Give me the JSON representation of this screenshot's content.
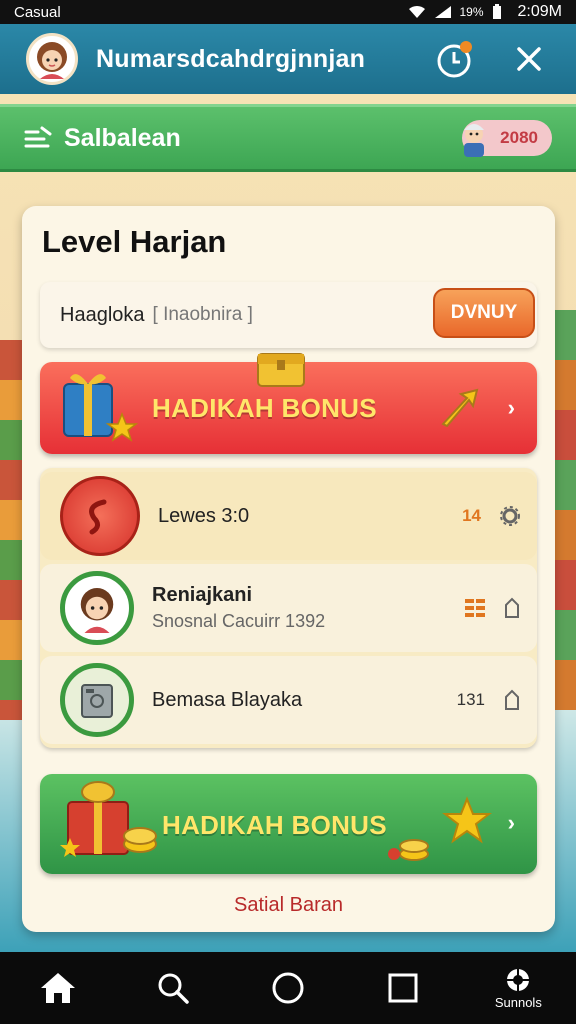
{
  "status_bar": {
    "carrier": "Casual",
    "battery": "19%",
    "time": "2:09M"
  },
  "app_bar": {
    "title": "Numarsdcahdrgjnnjan"
  },
  "green_bar": {
    "title": "Salbalean",
    "coin_value": "2080"
  },
  "panel": {
    "title": "Level Harjan",
    "search": {
      "label": "Haagloka",
      "placeholder": "[ Inaobnira ]",
      "button": "DVNUY"
    },
    "red_banner": {
      "label": "HADIKAH BONUS"
    },
    "list": [
      {
        "main": "Lewes 3:0",
        "sub": "",
        "value": "14"
      },
      {
        "main": "Reniajkani",
        "sub": "Snosnal Cacuirr 1392",
        "value": ""
      },
      {
        "main": "Bemasa Blayaka",
        "sub": "",
        "value": "131"
      }
    ],
    "green_banner": {
      "label": "HADIKAH BONUS"
    },
    "footer_link": "Satial Baran"
  },
  "nav": {
    "label_5": "Sunnols"
  },
  "colors": {
    "app_bar": "#1d6f8d",
    "green": "#3da653",
    "red": "#e63036",
    "orange": "#e9682a",
    "bonus_text": "#ffe66a"
  },
  "icons": [
    "avatar-girl",
    "timer-icon",
    "close-icon",
    "menu-edit-icon",
    "gift-box-icon",
    "star-icon",
    "arrow-icon",
    "coin-stack-icon",
    "home-icon",
    "search-icon",
    "circle-icon",
    "square-icon",
    "settings-icon"
  ]
}
